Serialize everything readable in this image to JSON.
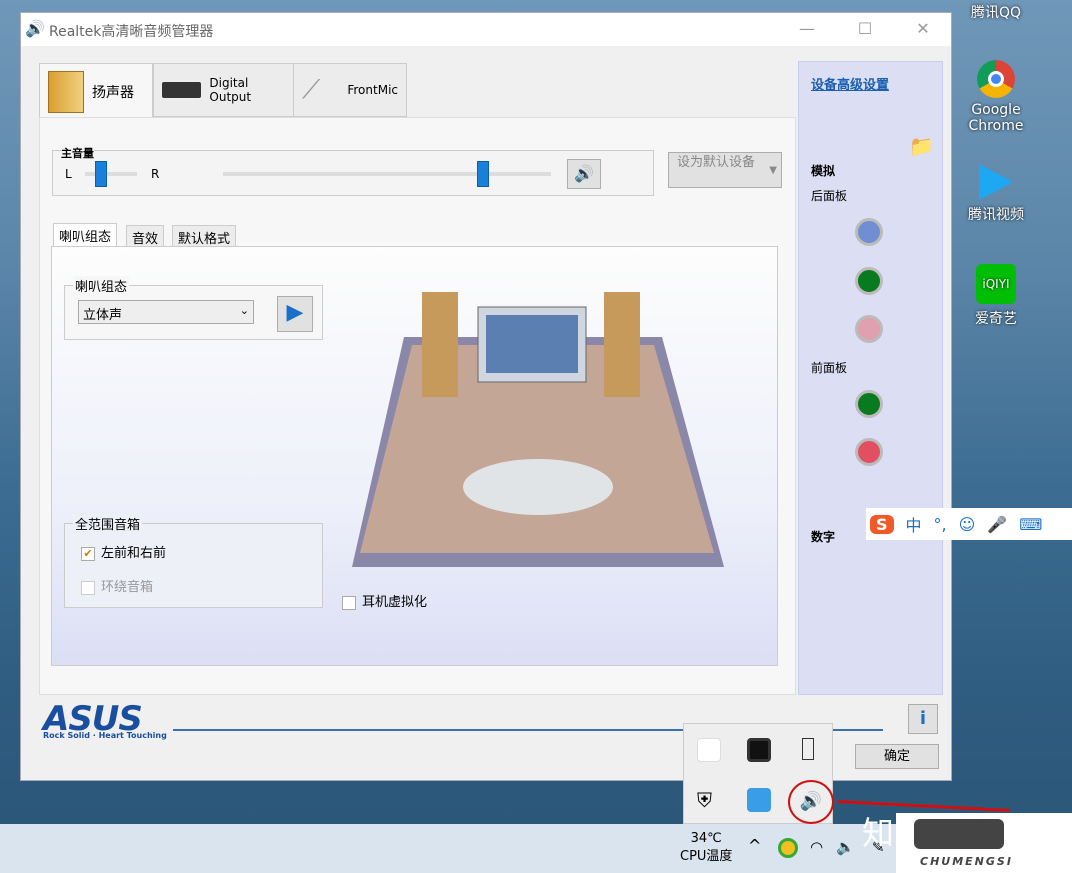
{
  "window": {
    "title": "Realtek高清晰音频管理器",
    "minimize": "—",
    "maximize": "☐",
    "close": "✕"
  },
  "device_tabs": [
    {
      "label": "扬声器"
    },
    {
      "label": "Digital Output"
    },
    {
      "label": "FrontMic"
    }
  ],
  "main_volume": {
    "label": "主音量",
    "left": "L",
    "right": "R",
    "balance_percent": 50,
    "volume_percent": 78
  },
  "set_default": {
    "label": "设为默认设备"
  },
  "sub_tabs": [
    {
      "label": "喇叭组态"
    },
    {
      "label": "音效"
    },
    {
      "label": "默认格式"
    }
  ],
  "speaker_config": {
    "label": "喇叭组态",
    "selected": "立体声"
  },
  "full_range": {
    "label": "全范围音箱",
    "front": {
      "label": "左前和右前",
      "checked": true
    },
    "surround": {
      "label": "环绕音箱",
      "checked": false,
      "disabled": true
    }
  },
  "headphone_virtualization": {
    "label": "耳机虚拟化",
    "checked": false
  },
  "right_panel": {
    "advanced_link": "设备高级设置",
    "analog": "模拟",
    "back_panel": "后面板",
    "front_panel": "前面板",
    "digital": "数字"
  },
  "colors": {
    "accent": "#1a7fd8",
    "link": "#1a5fb0",
    "jack_blue": "#6f8fd0",
    "jack_green": "#0a7a20",
    "jack_pink": "#e0a0b0",
    "jack_red": "#e05060"
  },
  "asus": {
    "logo": "ASUS",
    "tagline": "Rock Solid · Heart Touching"
  },
  "ok_button": "确定",
  "desktop_icons": [
    {
      "label": "腾讯QQ"
    },
    {
      "label": "Google Chrome"
    },
    {
      "label": "腾讯视频"
    },
    {
      "label": "爱奇艺"
    }
  ],
  "ime_bar": {
    "mode": "中",
    "punct": "°,"
  },
  "taskbar": {
    "temp": "34℃",
    "temp_label": "CPU温度"
  },
  "watermark": {
    "zhihu": "知",
    "brand": "CHUMENGSI"
  }
}
